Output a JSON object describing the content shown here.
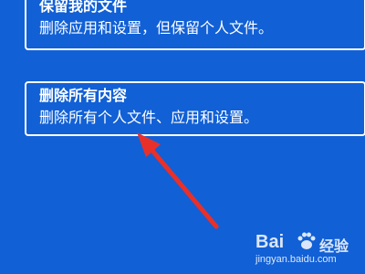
{
  "options": [
    {
      "title": "保留我的文件",
      "description": "删除应用和设置，但保留个人文件。"
    },
    {
      "title": "删除所有内容",
      "description": "删除所有个人文件、应用和设置。"
    }
  ],
  "watermark": {
    "logo_left": "Bai",
    "logo_right": "经验",
    "url": "jingyan.baidu.com"
  },
  "colors": {
    "background": "#1160d6",
    "border": "#ffffff",
    "arrow": "#e8302a"
  },
  "icons": {
    "annotation": "red-arrow-icon",
    "watermark": "baidu-paw-icon"
  }
}
